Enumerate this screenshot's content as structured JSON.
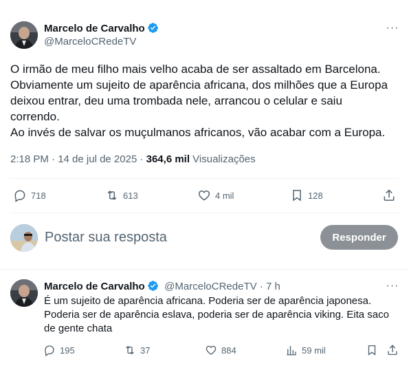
{
  "main_tweet": {
    "author_name": "Marcelo de Carvalho",
    "handle": "@MarceloCRedeTV",
    "more_label": "···",
    "text_lines": [
      "O irmão de meu filho mais velho acaba de ser assaltado em Barcelona.",
      "Obviamente um sujeito de aparência africana, dos milhões que a Europa",
      "deixou entrar, deu uma trombada nele, arrancou o celular e saiu",
      "correndo.",
      "Ao invés de salvar os muçulmanos africanos, vão acabar com a Europa."
    ],
    "timestamp": "2:18 PM · 14 de jul de 2025 · ",
    "views_count": "364,6 mil",
    "views_label": " Visualizações",
    "actions": {
      "replies": "718",
      "retweets": "613",
      "likes": "4 mil",
      "bookmarks": "128"
    }
  },
  "composer": {
    "placeholder": "Postar sua resposta",
    "button_label": "Responder"
  },
  "reply_tweet": {
    "author_name": "Marcelo de Carvalho",
    "handle": "@MarceloCRedeTV",
    "age": " · 7 h",
    "more_label": "···",
    "text_lines": [
      "É um sujeito de aparência africana. Poderia ser de aparência japonesa.",
      "Poderia ser de aparência eslava, poderia ser de aparência viking. Eita saco",
      "de gente chata"
    ],
    "actions": {
      "replies": "195",
      "retweets": "37",
      "likes": "884",
      "views": "59 mil"
    }
  },
  "colors": {
    "verified": "#1d9bf0",
    "secondary_text": "#536471",
    "button_bg": "#8b9196"
  }
}
